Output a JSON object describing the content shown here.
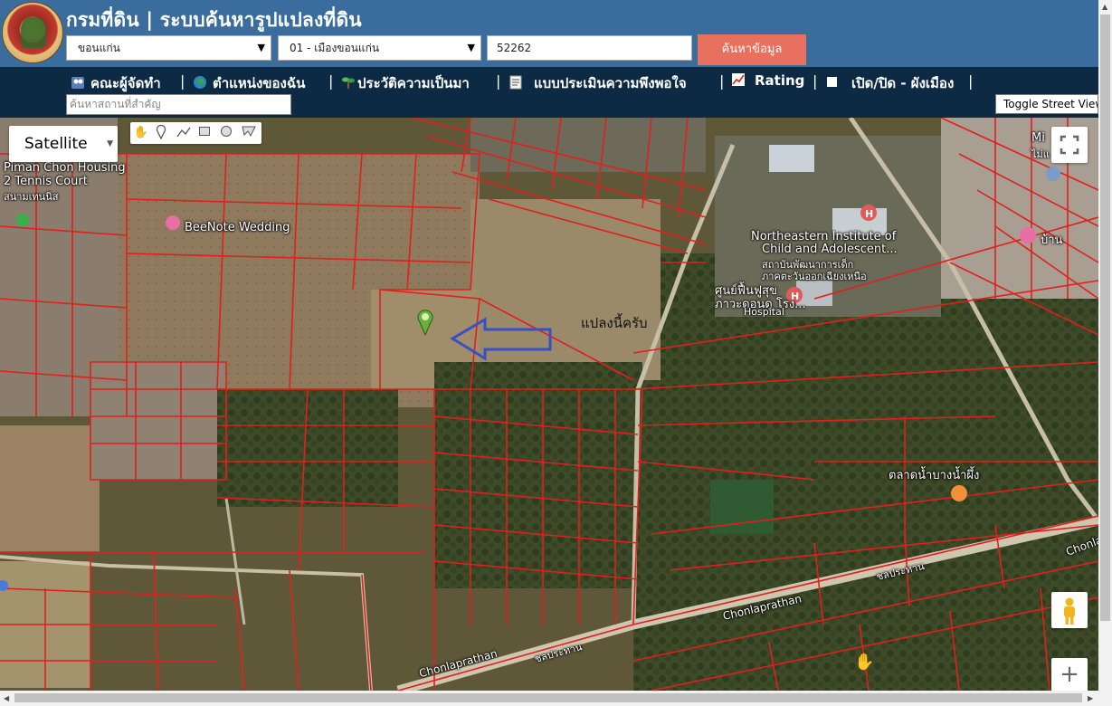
{
  "header": {
    "title": "กรมที่ดิน | ระบบค้นหารูปแปลงที่ดิน",
    "province_select": "ขอนแก่น",
    "district_select": "01 - เมืองขอนแก่น",
    "parcel_number": "52262",
    "search_button": "ค้นหาข้อมูล"
  },
  "nav": {
    "items": [
      {
        "label": "คณะผู้จัดทำ",
        "icon": "people-icon"
      },
      {
        "label": "ตำแหน่งของฉัน",
        "icon": "globe-icon"
      },
      {
        "label": "ประวัติความเป็นมา",
        "icon": "sprout-icon"
      },
      {
        "label": "แบบประเมินความพึงพอใจ",
        "icon": "document-icon"
      },
      {
        "label": "Rating",
        "icon": "chart-icon"
      },
      {
        "label": "เปิด/ปิด - ผังเมือง",
        "icon": "checkbox-icon"
      }
    ],
    "separator": "|",
    "place_search_placeholder": "ค้นหาสถานที่สำคัญ",
    "toggle_street_view": "Toggle Street View"
  },
  "map": {
    "type_control": "Satellite",
    "draw_tools": [
      "hand-icon",
      "marker-icon",
      "polyline-icon",
      "rectangle-icon",
      "circle-icon",
      "polygon-icon"
    ],
    "labels": {
      "piman": "Piman Chon Housing",
      "tennis": "2 Tennis Court",
      "tennis_sub": "สนามเทนนิส",
      "beenote": "BeeNote Wedding",
      "northeastern1": "Northeastern Institute of",
      "northeastern2": "Child and Adolescent...",
      "northeastern_th": "สถาบันพัฒนาการเด็ก",
      "northeastern_th2": "ภาคตะวันออกเฉียงเหนือ",
      "rehab1": "ศูนย์ฟื้นฟูสุข",
      "rehab2": "ภาวะดอนดู โรง...",
      "hospital": "Hospital",
      "market": "ตลาดน้ำบางน้ำผึ้ง",
      "road1": "Chonlaprathan",
      "road2": "Chonlaprathan",
      "road3": "Chonlaprathan",
      "road_th1": "ชลประทาน",
      "road_th2": "ชลประทาน",
      "mi": "Mi",
      "mai": "ไม่แ",
      "baan": "บ้าน",
      "annotation": "แปลงนี้ครับ"
    },
    "colors": {
      "parcel": "#e0201c",
      "arrow": "#3a4fc4",
      "header": "#3a6d9e",
      "navbar": "#0d2a44",
      "button": "#e8705f"
    }
  }
}
